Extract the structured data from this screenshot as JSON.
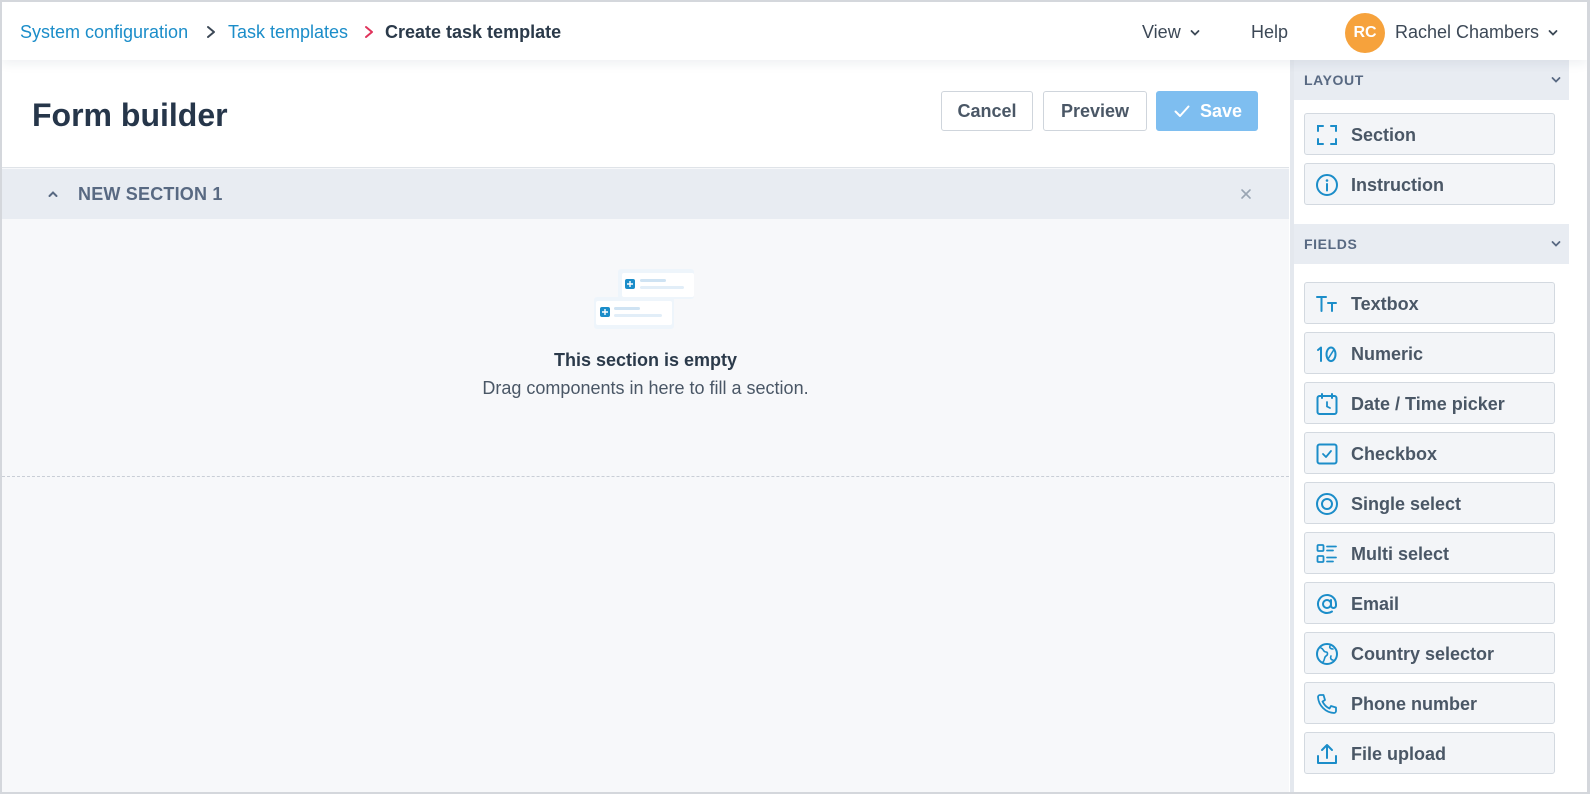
{
  "breadcrumb": {
    "items": [
      {
        "label": "System configuration"
      },
      {
        "label": "Task templates"
      },
      {
        "label": "Create task template"
      }
    ]
  },
  "nav": {
    "view_label": "View",
    "help_label": "Help",
    "user_initials": "RC",
    "user_name": "Rachel Chambers"
  },
  "page": {
    "title": "Form builder",
    "cancel_label": "Cancel",
    "preview_label": "Preview",
    "save_label": "Save"
  },
  "section": {
    "title": "NEW SECTION 1",
    "empty_title": "This section is empty",
    "empty_desc": "Drag components in here to fill a section."
  },
  "sidebar": {
    "layout_heading": "LAYOUT",
    "layout_items": [
      {
        "label": "Section",
        "icon": "section-icon"
      },
      {
        "label": "Instruction",
        "icon": "info-icon"
      }
    ],
    "fields_heading": "FIELDS",
    "field_items": [
      {
        "label": "Textbox",
        "icon": "text-icon"
      },
      {
        "label": "Numeric",
        "icon": "numeric-icon"
      },
      {
        "label": "Date / Time picker",
        "icon": "calendar-clock-icon"
      },
      {
        "label": "Checkbox",
        "icon": "checkbox-icon"
      },
      {
        "label": "Single select",
        "icon": "radio-icon"
      },
      {
        "label": "Multi select",
        "icon": "list-icon"
      },
      {
        "label": "Email",
        "icon": "at-icon"
      },
      {
        "label": "Country selector",
        "icon": "globe-icon"
      },
      {
        "label": "Phone number",
        "icon": "phone-icon"
      },
      {
        "label": "File upload",
        "icon": "upload-icon"
      }
    ]
  },
  "colors": {
    "accent": "#1b8dc9",
    "breadcrumb_separator_active": "#e0335b",
    "save_button": "#7ebef0",
    "avatar": "#f6a23c"
  }
}
